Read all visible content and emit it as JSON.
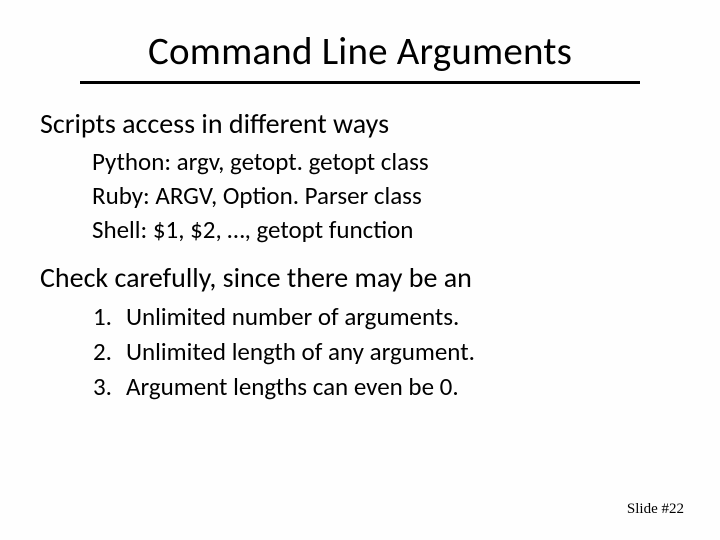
{
  "title": "Command Line Arguments",
  "section1": "Scripts access in different ways",
  "ways": {
    "python": "Python: argv, getopt. getopt class",
    "ruby": "Ruby: ARGV, Option. Parser class",
    "shell": "Shell: $1, $2, …, getopt function"
  },
  "section2": "Check carefully, since there may be an",
  "checks": {
    "n1": "1.",
    "t1": "Unlimited number of arguments.",
    "n2": "2.",
    "t2": "Unlimited length of any argument.",
    "n3": "3.",
    "t3": "Argument lengths can even be 0."
  },
  "footer": "Slide #22",
  "chart_data": {
    "type": "table",
    "title": "Command Line Arguments",
    "sections": [
      {
        "heading": "Scripts access in different ways",
        "items": [
          "Python: argv, getopt. getopt class",
          "Ruby: ARGV, Option. Parser class",
          "Shell: $1, $2, …, getopt function"
        ]
      },
      {
        "heading": "Check carefully, since there may be an",
        "items": [
          "Unlimited number of arguments.",
          "Unlimited length of any argument.",
          "Argument lengths can even be 0."
        ]
      }
    ],
    "slide_number": 22
  }
}
